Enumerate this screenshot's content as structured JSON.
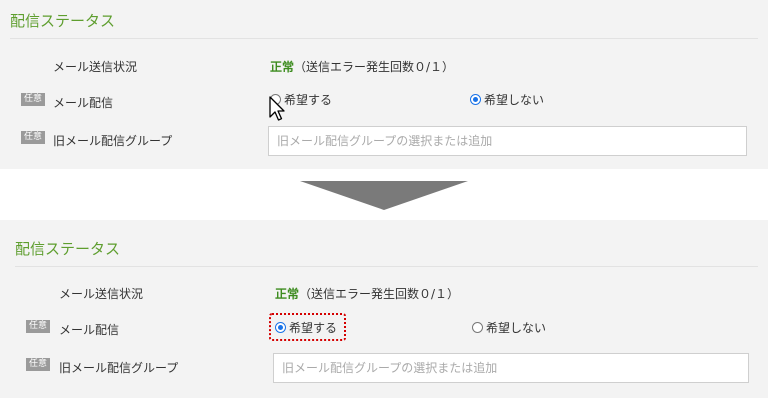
{
  "before": {
    "title": "配信ステータス",
    "status_label": "メール送信状況",
    "status_ok": "正常",
    "status_detail": "（送信エラー発生回数０/１）",
    "mail_badge": "任意",
    "mail_label": "メール配信",
    "radio_yes": "希望する",
    "radio_no": "希望しない",
    "selected": "希望しない",
    "group_badge": "任意",
    "group_label": "旧メール配信グループ",
    "group_placeholder": "旧メール配信グループの選択または追加"
  },
  "after": {
    "title": "配信ステータス",
    "status_label": "メール送信状況",
    "status_ok": "正常",
    "status_detail": "（送信エラー発生回数０/１）",
    "mail_badge": "任意",
    "mail_label": "メール配信",
    "radio_yes": "希望する",
    "radio_no": "希望しない",
    "selected": "希望する",
    "group_badge": "任意",
    "group_label": "旧メール配信グループ",
    "group_placeholder": "旧メール配信グループの選択または追加"
  },
  "colors": {
    "title_green": "#5e9e2e",
    "ok_green": "#3d8c1f",
    "radio_blue": "#1a73e8",
    "focus_red": "#d40000",
    "arrow_gray": "#7a7a7a"
  },
  "icons": {
    "transition": "down-arrow-icon",
    "pointer": "mouse-cursor-icon"
  }
}
